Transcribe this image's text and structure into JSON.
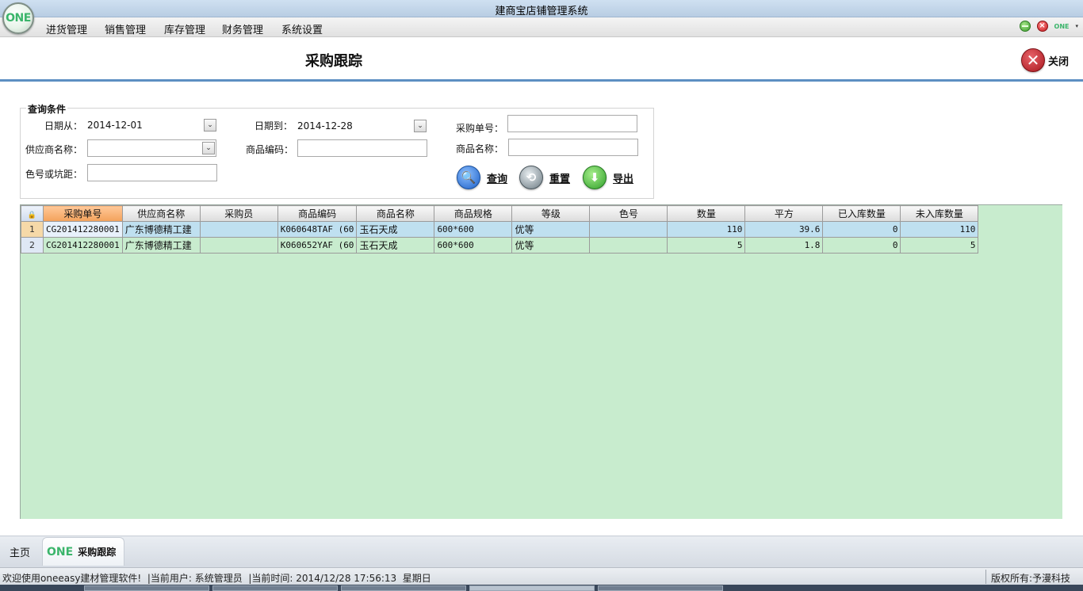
{
  "app": {
    "title": "建商宝店铺管理系统",
    "logo_text": "ONE"
  },
  "menu": [
    "进货管理",
    "销售管理",
    "库存管理",
    "财务管理",
    "系统设置"
  ],
  "window_controls": {
    "minimize_icon": "green-minus-icon",
    "close_icon": "red-close-icon",
    "brand_mini": "ONE",
    "dropdown_caret": "▾"
  },
  "page": {
    "title": "采购跟踪",
    "close_label": "关闭"
  },
  "query": {
    "legend": "查询条件",
    "date_from_label": "日期从：",
    "date_from_value": "2014-12-01",
    "date_to_label": "日期到：",
    "date_to_value": "2014-12-28",
    "order_no_label": "采购单号：",
    "order_no_value": "",
    "supplier_label": "供应商名称：",
    "supplier_value": "",
    "product_code_label": "商品编码：",
    "product_code_value": "",
    "product_name_label": "商品名称：",
    "product_name_value": "",
    "color_label": "色号或坑距：",
    "color_value": "",
    "dropdown_glyph": "⌄",
    "buttons": {
      "search": "查询",
      "reset": "重置",
      "export": "导出"
    },
    "button_icons": {
      "search": "🔍",
      "reset": "⟲",
      "export": "⬇"
    }
  },
  "grid": {
    "corner_icon": "lock-icon",
    "columns": [
      "采购单号",
      "供应商名称",
      "采购员",
      "商品编码",
      "商品名称",
      "商品规格",
      "等级",
      "色号",
      "数量",
      "平方",
      "已入库数量",
      "未入库数量"
    ],
    "rows": [
      {
        "n": "1",
        "order": "CG201412280001",
        "supplier": "广东博德精工建",
        "buyer": "",
        "code": "K060648TAF (60",
        "name": "玉石天成",
        "spec": "600*600",
        "grade": "优等",
        "color": "",
        "qty": "110",
        "sqm": "39.6",
        "in": "0",
        "notin": "110"
      },
      {
        "n": "2",
        "order": "CG201412280001",
        "supplier": "广东博德精工建",
        "buyer": "",
        "code": "K060652YAF (60",
        "name": "玉石天成",
        "spec": "600*600",
        "grade": "优等",
        "color": "",
        "qty": "5",
        "sqm": "1.8",
        "in": "0",
        "notin": "5"
      }
    ]
  },
  "tabs": {
    "home": "主页",
    "active_brand": "ONE",
    "active": "采购跟踪"
  },
  "status": {
    "left": "欢迎使用oneeasy建材管理软件!  |当前用户: 系统管理员  |当前时间: 2014/12/28 17:56:13  星期日",
    "right": "版权所有:予漫科技"
  },
  "colors": {
    "accent": "#5d8fc2",
    "grid_bg": "#c8ecce",
    "row_selected": "#bfe0f0",
    "sorted_header": "#f3a25b"
  }
}
